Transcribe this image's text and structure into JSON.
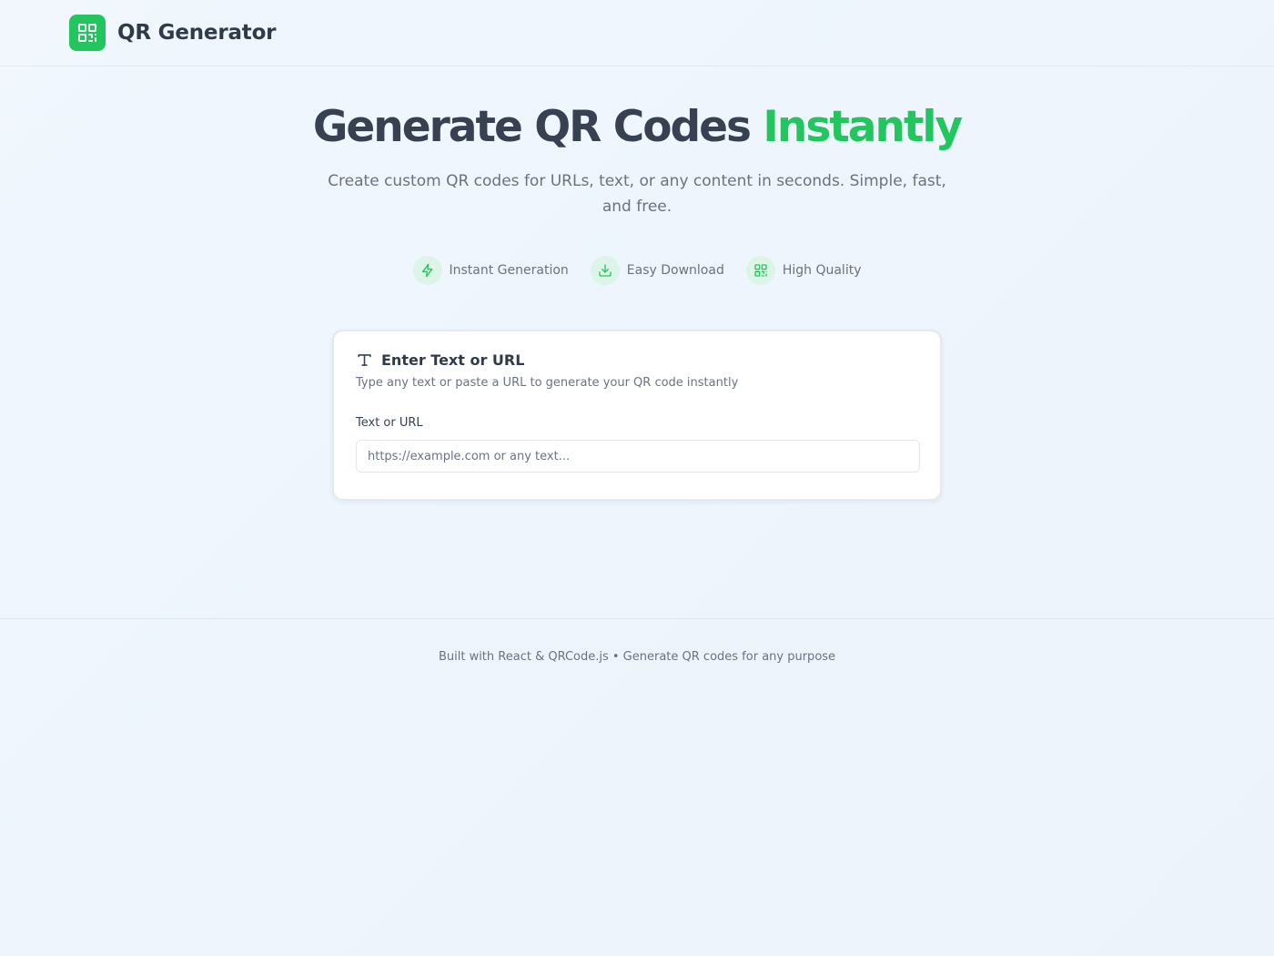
{
  "header": {
    "brand": "QR Generator",
    "logo_icon": "qr-code-icon"
  },
  "hero": {
    "title_main": "Generate QR Codes",
    "title_accent": "Instantly",
    "subtitle": "Create custom QR codes for URLs, text, or any content in seconds. Simple, fast, and free."
  },
  "features": [
    {
      "label": "Instant Generation",
      "icon": "lightning-icon"
    },
    {
      "label": "Easy Download",
      "icon": "download-icon"
    },
    {
      "label": "High Quality",
      "icon": "qr-code-icon"
    }
  ],
  "card": {
    "icon": "text-icon",
    "title": "Enter Text or URL",
    "description": "Type any text or paste a URL to generate your QR code instantly",
    "field_label": "Text or URL",
    "input_value": "",
    "input_placeholder": "https://example.com or any text..."
  },
  "footer": {
    "text": "Built with React & QRCode.js • Generate QR codes for any purpose"
  },
  "colors": {
    "accent": "#22c55e",
    "text_dark": "#374151",
    "text_muted": "#6b7280",
    "icon_bg": "#dcf5e6"
  }
}
